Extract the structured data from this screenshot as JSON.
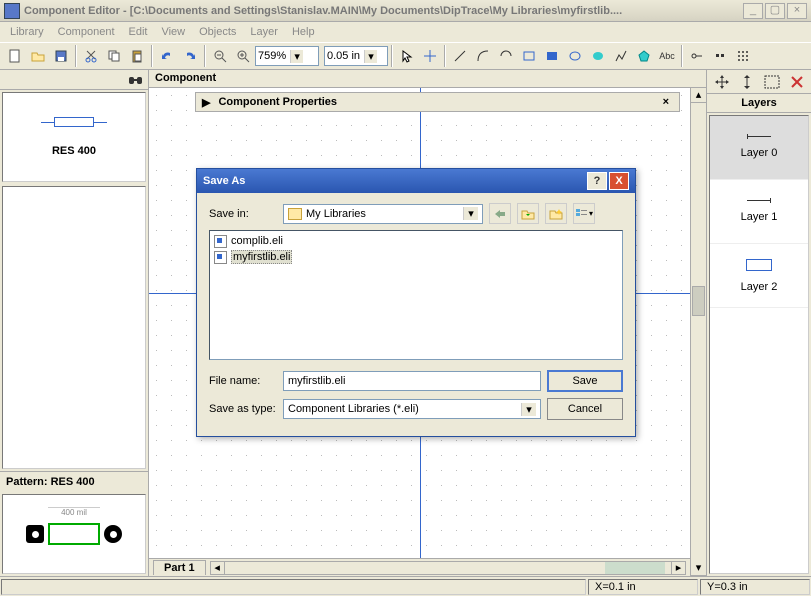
{
  "window": {
    "title": "Component Editor - [C:\\Documents and Settings\\Stanislav.MAIN\\My Documents\\DipTrace\\My Libraries\\myfirstlib....",
    "min": "_",
    "max": "▢",
    "close": "×"
  },
  "menu": {
    "items": [
      "Library",
      "Component",
      "Edit",
      "View",
      "Objects",
      "Layer",
      "Help"
    ]
  },
  "toolbar": {
    "zoom": "759%",
    "grid": "0.05 in"
  },
  "left": {
    "preview_label": "RES 400",
    "pattern_label": "Pattern: RES 400",
    "fp_dim": "400 mil"
  },
  "center": {
    "title": "Component",
    "props_title": "Component Properties",
    "part_tab": "Part 1"
  },
  "right": {
    "title": "Layers",
    "layers": [
      "Layer 0",
      "Layer 1",
      "Layer 2"
    ]
  },
  "status": {
    "x": "X=0.1 in",
    "y": "Y=0.3 in"
  },
  "dialog": {
    "title": "Save As",
    "savein_label": "Save in:",
    "savein_value": "My Libraries",
    "files": [
      "complib.eli",
      "myfirstlib.eli"
    ],
    "filename_label": "File name:",
    "filename_value": "myfirstlib.eli",
    "type_label": "Save as type:",
    "type_value": "Component Libraries (*.eli)",
    "save_btn": "Save",
    "cancel_btn": "Cancel"
  }
}
